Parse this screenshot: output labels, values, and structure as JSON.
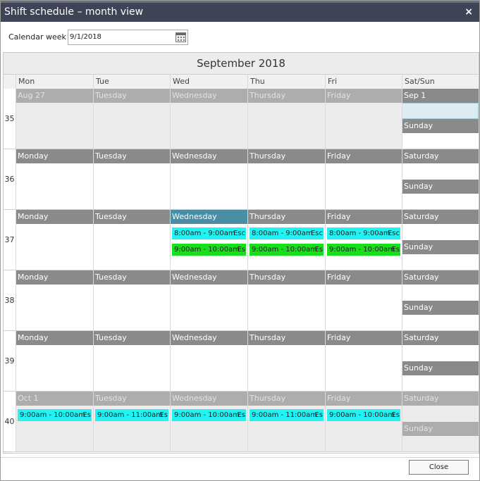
{
  "window": {
    "title": "Shift schedule – month view",
    "close_glyph": "×"
  },
  "week_field": {
    "label": "Calendar week",
    "value": "9/1/2018",
    "icon": "calendar-icon"
  },
  "calendar": {
    "month_title": "September 2018",
    "day_headers": [
      "Mon",
      "Tue",
      "Wed",
      "Thu",
      "Fri",
      "Sat/Sun"
    ],
    "weeks": [
      {
        "number": "35",
        "days": [
          {
            "label": "Aug 27",
            "style": "light"
          },
          {
            "label": "Tuesday",
            "style": "light"
          },
          {
            "label": "Wednesday",
            "style": "light"
          },
          {
            "label": "Thursday",
            "style": "light"
          },
          {
            "label": "Friday",
            "style": "light"
          },
          {
            "label": "Sep 1",
            "style": "dark"
          }
        ],
        "sunday": {
          "label": "Sunday",
          "style": "dark"
        },
        "events": []
      },
      {
        "number": "36",
        "days": [
          {
            "label": "Monday",
            "style": "dark"
          },
          {
            "label": "Tuesday",
            "style": "dark"
          },
          {
            "label": "Wednesday",
            "style": "dark"
          },
          {
            "label": "Thursday",
            "style": "dark"
          },
          {
            "label": "Friday",
            "style": "dark"
          },
          {
            "label": "Saturday",
            "style": "dark"
          }
        ],
        "sunday": {
          "label": "Sunday",
          "style": "dark"
        },
        "events": []
      },
      {
        "number": "37",
        "days": [
          {
            "label": "Monday",
            "style": "dark"
          },
          {
            "label": "Tuesday",
            "style": "dark"
          },
          {
            "label": "Wednesday",
            "style": "hi"
          },
          {
            "label": "Thursday",
            "style": "dark"
          },
          {
            "label": "Friday",
            "style": "dark"
          },
          {
            "label": "Saturday",
            "style": "dark"
          }
        ],
        "sunday": {
          "label": "Sunday",
          "style": "dark"
        },
        "events": [
          {
            "day": 2,
            "slot": 0,
            "time": "8:00am - 9:00am",
            "extra": "Esc",
            "color": "cyan"
          },
          {
            "day": 2,
            "slot": 1,
            "time": "9:00am - 10:00am",
            "extra": "Es",
            "color": "green"
          },
          {
            "day": 3,
            "slot": 0,
            "time": "8:00am - 9:00am",
            "extra": "Esc",
            "color": "cyan"
          },
          {
            "day": 3,
            "slot": 1,
            "time": "9:00am - 10:00am",
            "extra": "Es",
            "color": "green"
          },
          {
            "day": 4,
            "slot": 0,
            "time": "8:00am - 9:00am",
            "extra": "Esc",
            "color": "cyan"
          },
          {
            "day": 4,
            "slot": 1,
            "time": "9:00am - 10:00am",
            "extra": "Es",
            "color": "green"
          }
        ]
      },
      {
        "number": "38",
        "days": [
          {
            "label": "Monday",
            "style": "dark"
          },
          {
            "label": "Tuesday",
            "style": "dark"
          },
          {
            "label": "Wednesday",
            "style": "dark"
          },
          {
            "label": "Thursday",
            "style": "dark"
          },
          {
            "label": "Friday",
            "style": "dark"
          },
          {
            "label": "Saturday",
            "style": "dark"
          }
        ],
        "sunday": {
          "label": "Sunday",
          "style": "dark"
        },
        "events": []
      },
      {
        "number": "39",
        "days": [
          {
            "label": "Monday",
            "style": "dark"
          },
          {
            "label": "Tuesday",
            "style": "dark"
          },
          {
            "label": "Wednesday",
            "style": "dark"
          },
          {
            "label": "Thursday",
            "style": "dark"
          },
          {
            "label": "Friday",
            "style": "dark"
          },
          {
            "label": "Saturday",
            "style": "dark"
          }
        ],
        "sunday": {
          "label": "Sunday",
          "style": "dark"
        },
        "events": []
      },
      {
        "number": "40",
        "days": [
          {
            "label": "Oct 1",
            "style": "light"
          },
          {
            "label": "Tuesday",
            "style": "light"
          },
          {
            "label": "Wednesday",
            "style": "light"
          },
          {
            "label": "Thursday",
            "style": "light"
          },
          {
            "label": "Friday",
            "style": "light"
          },
          {
            "label": "Saturday",
            "style": "light"
          }
        ],
        "sunday": {
          "label": "Sunday",
          "style": "light"
        },
        "events": [
          {
            "day": 0,
            "slot": 0,
            "time": "9:00am - 10:00am",
            "extra": "Es",
            "color": "cyan"
          },
          {
            "day": 1,
            "slot": 0,
            "time": "9:00am - 11:00am",
            "extra": "Es",
            "color": "cyan"
          },
          {
            "day": 2,
            "slot": 0,
            "time": "9:00am - 10:00am",
            "extra": "Es",
            "color": "cyan"
          },
          {
            "day": 3,
            "slot": 0,
            "time": "9:00am - 11:00am",
            "extra": "Es",
            "color": "cyan"
          },
          {
            "day": 4,
            "slot": 0,
            "time": "9:00am - 10:00am",
            "extra": "Es",
            "color": "cyan"
          }
        ]
      }
    ]
  },
  "footer": {
    "close_label": "Close"
  }
}
